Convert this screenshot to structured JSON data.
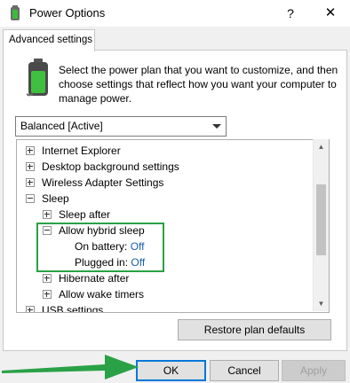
{
  "window": {
    "title": "Power Options",
    "help_glyph": "?",
    "close_glyph": "✕"
  },
  "tab": {
    "label": "Advanced settings"
  },
  "description": "Select the power plan that you want to customize, and then choose settings that reflect how you want your computer to manage power.",
  "plan_select": {
    "value": "Balanced [Active]"
  },
  "tree": {
    "items": [
      {
        "label": "Internet Explorer",
        "state": "collapsed"
      },
      {
        "label": "Desktop background settings",
        "state": "collapsed"
      },
      {
        "label": "Wireless Adapter Settings",
        "state": "collapsed"
      },
      {
        "label": "Sleep",
        "state": "expanded"
      },
      {
        "label": "Sleep after",
        "state": "collapsed"
      },
      {
        "label": "Allow hybrid sleep",
        "state": "expanded"
      },
      {
        "label": "On battery:",
        "value": "Off"
      },
      {
        "label": "Plugged in:",
        "value": "Off"
      },
      {
        "label": "Hibernate after",
        "state": "collapsed"
      },
      {
        "label": "Allow wake timers",
        "state": "collapsed"
      },
      {
        "label": "USB settings",
        "state": "collapsed"
      }
    ]
  },
  "buttons": {
    "restore": "Restore plan defaults",
    "ok": "OK",
    "cancel": "Cancel",
    "apply": "Apply"
  },
  "icons": {
    "window_icon": "power-options-icon",
    "battery_icon": "battery-plan-icon",
    "annotation": "green-arrow-icon"
  },
  "colors": {
    "highlight_box": "#2aa146",
    "link": "#1a5ea8",
    "ok_border": "#0078d7"
  }
}
